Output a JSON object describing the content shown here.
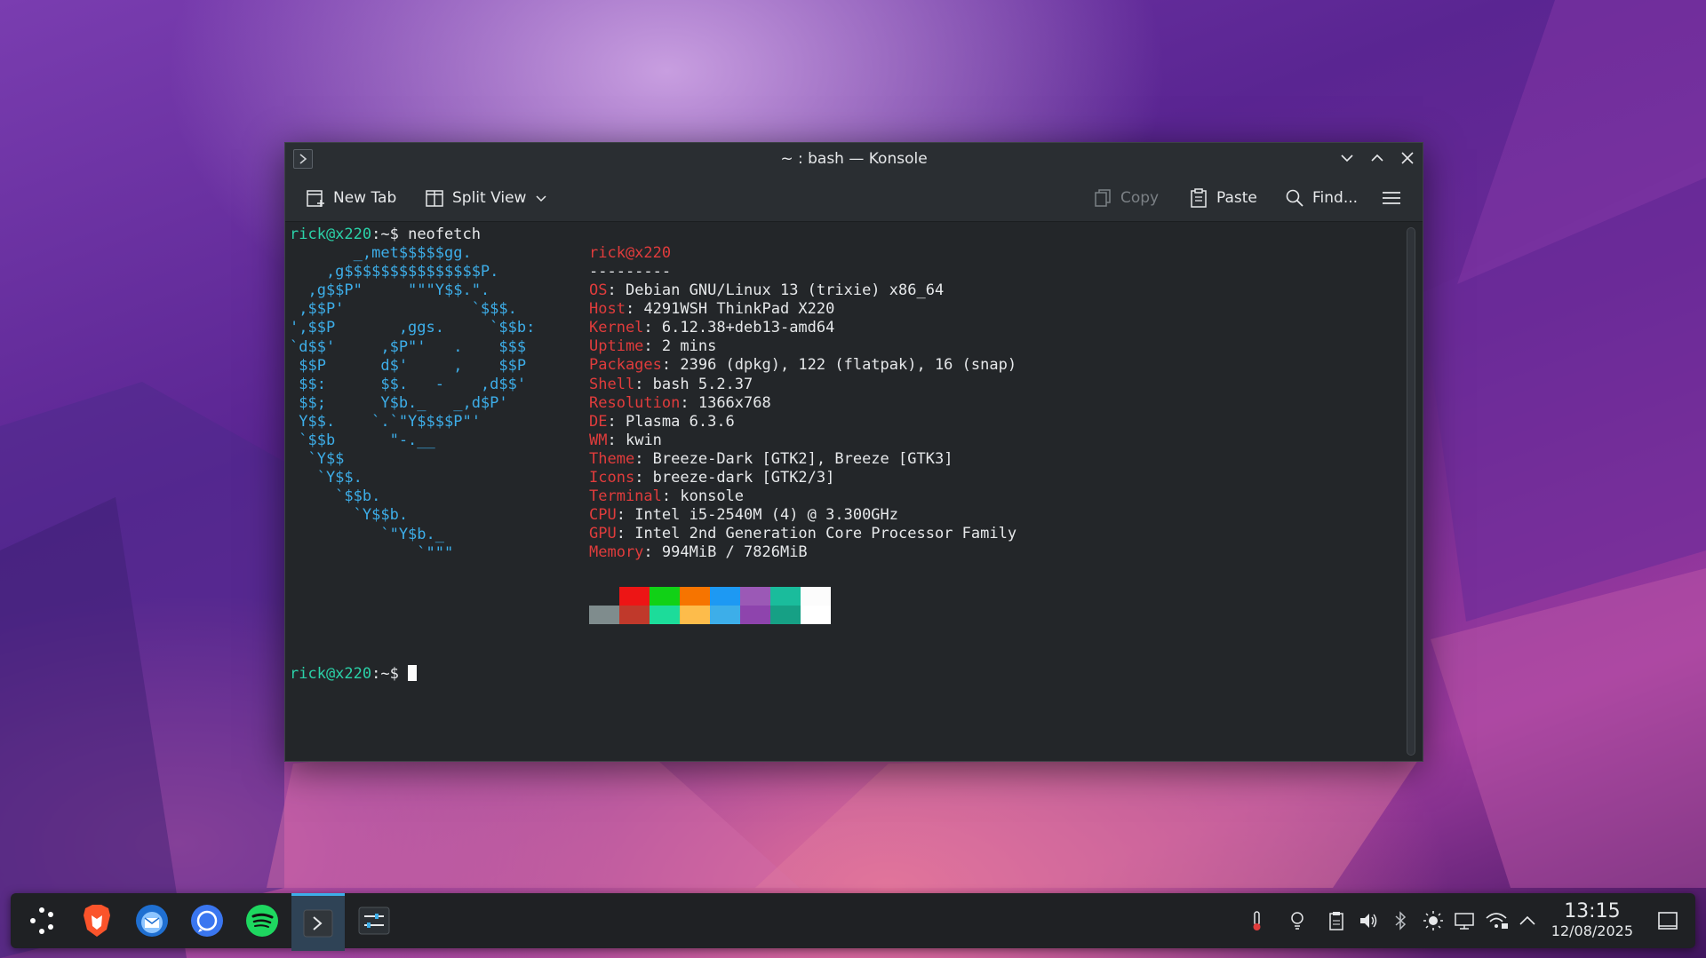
{
  "window": {
    "title": "~ : bash — Konsole",
    "toolbar": {
      "new_tab": "New Tab",
      "split_view": "Split View",
      "copy": "Copy",
      "paste": "Paste",
      "find": "Find..."
    }
  },
  "terminal": {
    "prompt": "rick@x220",
    "prompt_suffix": ":~$ ",
    "command": "neofetch",
    "logo_lines": [
      "       _,met$$$$$gg.",
      "    ,g$$$$$$$$$$$$$$$P.",
      "  ,g$$P\"     \"\"\"Y$$.\".",
      " ,$$P'              `$$$.",
      "',$$P       ,ggs.     `$$b:",
      "`d$$'     ,$P\"'   .    $$$",
      " $$P      d$'     ,    $$P",
      " $$:      $$.   -    ,d$$'",
      " $$;      Y$b._   _,d$P'",
      " Y$$.    `.`\"Y$$$$P\"'",
      " `$$b      \"-.__",
      "  `Y$$",
      "   `Y$$.",
      "     `$$b.",
      "       `Y$$b.",
      "          `\"Y$b._",
      "              `\"\"\""
    ],
    "user_host": "rick@x220",
    "separator": "---------",
    "info": [
      {
        "key": "OS",
        "value": "Debian GNU/Linux 13 (trixie) x86_64"
      },
      {
        "key": "Host",
        "value": "4291WSH ThinkPad X220"
      },
      {
        "key": "Kernel",
        "value": "6.12.38+deb13-amd64"
      },
      {
        "key": "Uptime",
        "value": "2 mins"
      },
      {
        "key": "Packages",
        "value": "2396 (dpkg), 122 (flatpak), 16 (snap)"
      },
      {
        "key": "Shell",
        "value": "bash 5.2.37"
      },
      {
        "key": "Resolution",
        "value": "1366x768"
      },
      {
        "key": "DE",
        "value": "Plasma 6.3.6"
      },
      {
        "key": "WM",
        "value": "kwin"
      },
      {
        "key": "Theme",
        "value": "Breeze-Dark [GTK2], Breeze [GTK3]"
      },
      {
        "key": "Icons",
        "value": "breeze-dark [GTK2/3]"
      },
      {
        "key": "Terminal",
        "value": "konsole"
      },
      {
        "key": "CPU",
        "value": "Intel i5-2540M (4) @ 3.300GHz"
      },
      {
        "key": "GPU",
        "value": "Intel 2nd Generation Core Processor Family"
      },
      {
        "key": "Memory",
        "value": "994MiB / 7826MiB"
      }
    ],
    "palette_top": [
      "#232629",
      "#ed1515",
      "#11d116",
      "#f67400",
      "#1d99f3",
      "#9b59b6",
      "#1abc9c",
      "#fcfcfc"
    ],
    "palette_bottom": [
      "#7f8c8d",
      "#c0392b",
      "#1cdc9a",
      "#fdbc4b",
      "#3daee9",
      "#8e44ad",
      "#16a085",
      "#ffffff"
    ]
  },
  "taskbar": {
    "apps": [
      "launcher-icon",
      "brave-icon",
      "thunderbird-icon",
      "signal-icon",
      "spotify-icon",
      "konsole-icon",
      "system-settings-icon"
    ],
    "clock_time": "13:15",
    "clock_date": "12/08/2025"
  }
}
